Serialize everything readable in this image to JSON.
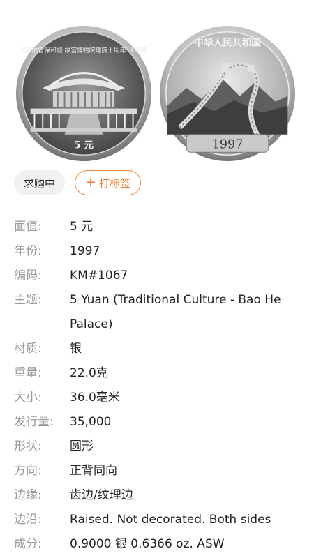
{
  "coins": {
    "obverse": {
      "inscription": "北京故宫保和殿 故宫博物院建院十周年1420年",
      "denomination": "5 元"
    },
    "reverse": {
      "inscription": "中华人民共和国",
      "year": "1997"
    }
  },
  "tags": {
    "status": "求购中",
    "add_tag_label": "打标签",
    "add_tag_icon": "plus-icon"
  },
  "attributes": [
    {
      "label": "面值:",
      "value": "5 元"
    },
    {
      "label": "年份:",
      "value": "1997"
    },
    {
      "label": "编码:",
      "value": "KM#1067"
    },
    {
      "label": "主题:",
      "value": "5 Yuan (Traditional Culture - Bao He Palace)"
    },
    {
      "label": "材质:",
      "value": "银"
    },
    {
      "label": "重量:",
      "value": "22.0克"
    },
    {
      "label": "大小:",
      "value": "36.0毫米"
    },
    {
      "label": "发行量:",
      "value": "35,000"
    },
    {
      "label": "形状:",
      "value": "圆形"
    },
    {
      "label": "方向:",
      "value": "正背同向"
    },
    {
      "label": "边缘:",
      "value": "齿边/纹理边"
    },
    {
      "label": "边沿:",
      "value": "Raised. Not decorated. Both sides"
    },
    {
      "label": "成分:",
      "value": "0.9000 银 0.6366 oz. ASW"
    }
  ],
  "colors": {
    "accent": "#ef7a2c",
    "label_gray": "#9a9a9a",
    "chip_bg": "#f1f1f1"
  }
}
